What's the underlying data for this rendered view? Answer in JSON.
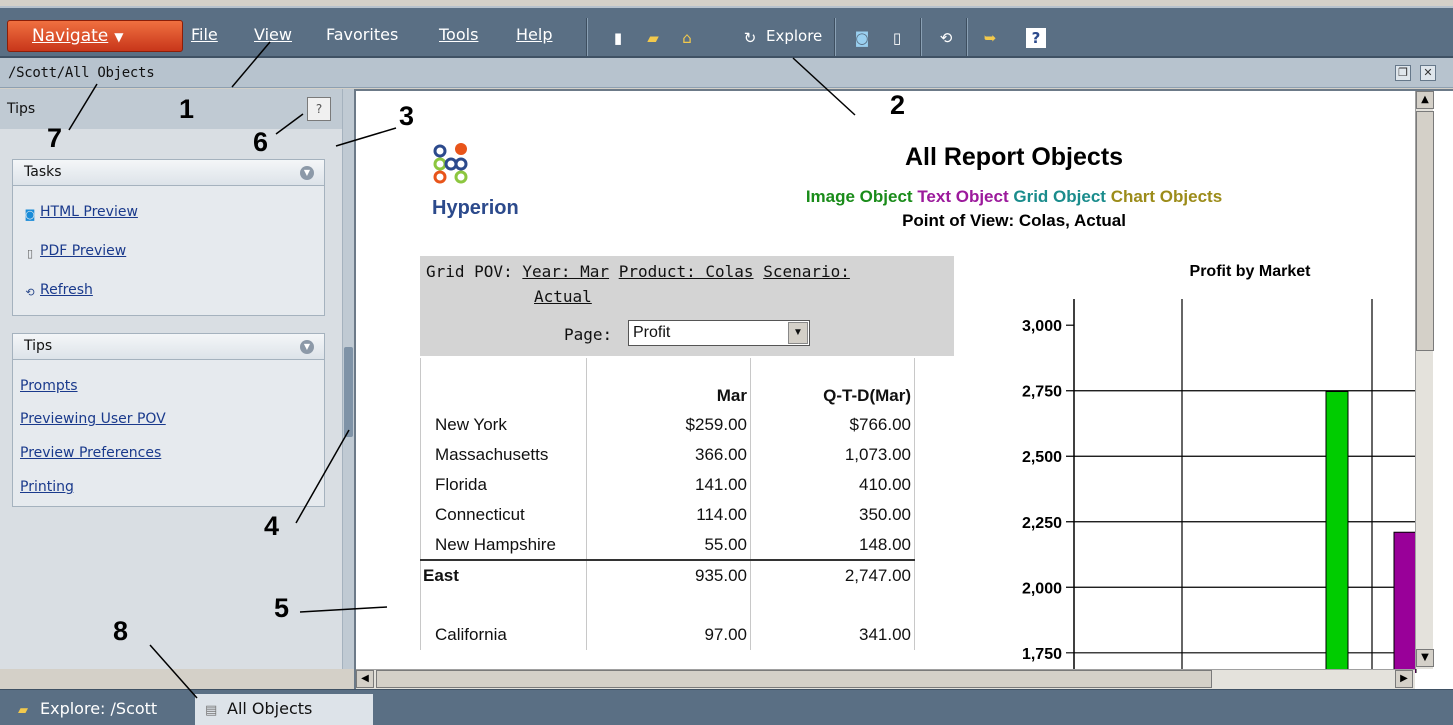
{
  "menubar": {
    "navigate_label": "Navigate",
    "menus": [
      "File",
      "View",
      "Favorites",
      "Tools",
      "Help"
    ],
    "explore_label": "Explore"
  },
  "pathbar": {
    "path": "/Scott/All Objects"
  },
  "left_panel": {
    "header_label": "Tips",
    "tasks": {
      "title": "Tasks",
      "items": [
        {
          "label": "HTML Preview",
          "icon": "html-preview-icon"
        },
        {
          "label": "PDF Preview",
          "icon": "pdf-document-icon"
        },
        {
          "label": "Refresh",
          "icon": "refresh-icon"
        }
      ]
    },
    "tips": {
      "title": "Tips",
      "items": [
        "Prompts",
        "Previewing User POV",
        "Preview Preferences",
        "Printing"
      ]
    }
  },
  "report": {
    "logo_text": "Hyperion",
    "title": "All Report Objects",
    "subtitle": [
      {
        "text": "Image Object",
        "color": "#1a8c1a"
      },
      {
        "text": "Text Object",
        "color": "#9c1a9c"
      },
      {
        "text": "Grid Object",
        "color": "#1a8c8c"
      },
      {
        "text": "Chart Objects",
        "color": "#9c8c1a"
      }
    ],
    "pov": "Point of View: Colas, Actual",
    "grid_pov": {
      "label": "Grid POV:",
      "year": "Year: Mar",
      "product": "Product: Colas",
      "scenario": "Scenario:",
      "scenario_value": "Actual",
      "page_label": "Page:",
      "page_value": "Profit"
    },
    "grid": {
      "columns": [
        "",
        "Mar",
        "Q-T-D(Mar)"
      ],
      "rows": [
        {
          "name": "New York",
          "mar": "$259.00",
          "qtd": "$766.00",
          "total": false
        },
        {
          "name": "Massachusetts",
          "mar": "366.00",
          "qtd": "1,073.00",
          "total": false
        },
        {
          "name": "Florida",
          "mar": "141.00",
          "qtd": "410.00",
          "total": false
        },
        {
          "name": "Connecticut",
          "mar": "114.00",
          "qtd": "350.00",
          "total": false
        },
        {
          "name": "New Hampshire",
          "mar": "55.00",
          "qtd": "148.00",
          "total": false
        },
        {
          "name": "East",
          "mar": "935.00",
          "qtd": "2,747.00",
          "total": true
        },
        {
          "name": "",
          "mar": "",
          "qtd": "",
          "total": false
        },
        {
          "name": "California",
          "mar": "97.00",
          "qtd": "341.00",
          "total": false
        }
      ]
    }
  },
  "chart_data": {
    "type": "bar",
    "title": "Profit by Market",
    "ylabel": "",
    "ylim": [
      1650,
      3100
    ],
    "yticks": [
      "3,000",
      "2,750",
      "2,500",
      "2,250",
      "2,000",
      "1,750"
    ],
    "ytick_values": [
      3000,
      2750,
      2500,
      2250,
      2000,
      1750
    ],
    "series": [
      {
        "value": 2747,
        "color": "#00cc00"
      },
      {
        "value": 2210,
        "color": "#990099"
      }
    ]
  },
  "tabs": [
    {
      "label": "Explore: /Scott",
      "active": false
    },
    {
      "label": "All Objects",
      "active": true
    }
  ],
  "callouts": [
    "1",
    "2",
    "3",
    "4",
    "5",
    "6",
    "7",
    "8"
  ]
}
